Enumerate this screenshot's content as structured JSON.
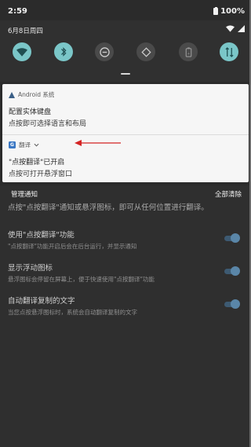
{
  "status_bar": {
    "time": "2:59",
    "battery": "100%"
  },
  "quick_settings": {
    "date": "6月8日周四",
    "tiles": [
      {
        "icon": "wifi-icon",
        "state": "on"
      },
      {
        "icon": "bluetooth-icon",
        "state": "on"
      },
      {
        "icon": "do-not-disturb-icon",
        "state": "off"
      },
      {
        "icon": "auto-rotate-icon",
        "state": "off"
      },
      {
        "icon": "battery-saver-icon",
        "state": "off"
      },
      {
        "icon": "data-transfer-icon",
        "state": "on"
      }
    ],
    "accent": "#7ac6c8"
  },
  "notifications": [
    {
      "app": "Android 系统",
      "title": "配置实体键盘",
      "text": "点按即可选择语言和布局"
    },
    {
      "app": "翻译",
      "title": "\"点按翻译\"已开启",
      "text": "点按可打开悬浮窗口"
    }
  ],
  "footer": {
    "manage": "管理通知",
    "clear_all": "全部清除"
  },
  "background_app": {
    "description": "点按\"点按翻译\"通知或悬浮图标，即可从任何位置进行翻译。",
    "settings": [
      {
        "title": "使用\"点按翻译\"功能",
        "subtitle": "\"点按翻译\"功能开启后会在后台运行，并显示通知"
      },
      {
        "title": "显示浮动图标",
        "subtitle": "悬浮图标会停留在屏幕上，便于快速使用\"点按翻译\"功能"
      },
      {
        "title": "自动翻译复制的文字",
        "subtitle": "当您点按悬浮图标时，系统会自动翻译复制的文字"
      }
    ]
  },
  "annotation_color": "#d42323"
}
